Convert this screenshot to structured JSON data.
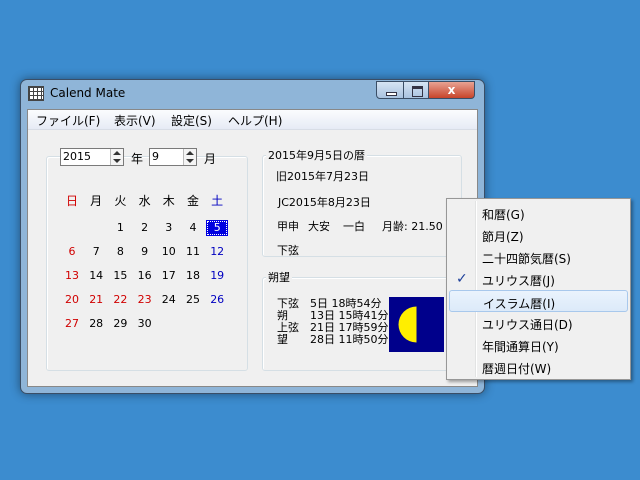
{
  "window": {
    "title": "Calend Mate",
    "close_glyph": "x"
  },
  "menubar": {
    "items": [
      "ファイル(F)",
      "表示(V)",
      "設定(S)",
      "ヘルプ(H)"
    ]
  },
  "calendar": {
    "year_value": "2015",
    "year_unit": "年",
    "month_value": "9",
    "month_unit": "月",
    "weekdays": [
      {
        "label": "日",
        "color": "#d00000"
      },
      {
        "label": "月",
        "color": "#000000"
      },
      {
        "label": "火",
        "color": "#000000"
      },
      {
        "label": "水",
        "color": "#000000"
      },
      {
        "label": "木",
        "color": "#000000"
      },
      {
        "label": "金",
        "color": "#000000"
      },
      {
        "label": "土",
        "color": "#0000c0"
      }
    ],
    "weeks": [
      [
        "",
        "",
        "1",
        "2",
        "3",
        "4",
        "5"
      ],
      [
        "6",
        "7",
        "8",
        "9",
        "10",
        "11",
        "12"
      ],
      [
        "13",
        "14",
        "15",
        "16",
        "17",
        "18",
        "19"
      ],
      [
        "20",
        "21",
        "22",
        "23",
        "24",
        "25",
        "26"
      ],
      [
        "27",
        "28",
        "29",
        "30",
        "",
        "",
        ""
      ]
    ],
    "red_days": [
      "6",
      "13",
      "20",
      "21",
      "22",
      "23",
      "27"
    ],
    "blue_days": [
      "12",
      "19",
      "26"
    ],
    "selected_day": "5",
    "selected_color": "#0000e0"
  },
  "koyomi": {
    "title": "2015年9月5日の暦",
    "old_calendar": "旧2015年7月23日",
    "julian": "JC2015年8月23日",
    "kanshi": "甲申",
    "rokuyo": "大安",
    "kyusei": "一白",
    "moon_age": "月齢: 21.50",
    "phase": "下弦"
  },
  "sakubo": {
    "title": "朔望",
    "rows": [
      {
        "name": "下弦",
        "time": "5日 18時54分"
      },
      {
        "name": "朔",
        "time": "13日 15時41分"
      },
      {
        "name": "上弦",
        "time": "21日 17時59分"
      },
      {
        "name": "望",
        "time": "28日 11時50分"
      }
    ],
    "moon_fraction_lit": 0.5,
    "moon_waning": true,
    "moon_color": "#ffee00",
    "sky_color": "#00008b"
  },
  "context_menu": {
    "items": [
      {
        "label": "和暦(G)",
        "checked": false,
        "highlighted": false
      },
      {
        "label": "節月(Z)",
        "checked": false,
        "highlighted": false
      },
      {
        "label": "二十四節気暦(S)",
        "checked": false,
        "highlighted": false
      },
      {
        "label": "ユリウス暦(J)",
        "checked": true,
        "highlighted": false
      },
      {
        "label": "イスラム暦(I)",
        "checked": false,
        "highlighted": true
      },
      {
        "label": "ユリウス通日(D)",
        "checked": false,
        "highlighted": false
      },
      {
        "label": "年間通算日(Y)",
        "checked": false,
        "highlighted": false
      },
      {
        "label": "暦週日付(W)",
        "checked": false,
        "highlighted": false
      }
    ],
    "check_glyph": "✓"
  },
  "colors": {
    "desktop": "#3c8ccf",
    "sunday": "#d00000",
    "saturday": "#0000c0"
  }
}
